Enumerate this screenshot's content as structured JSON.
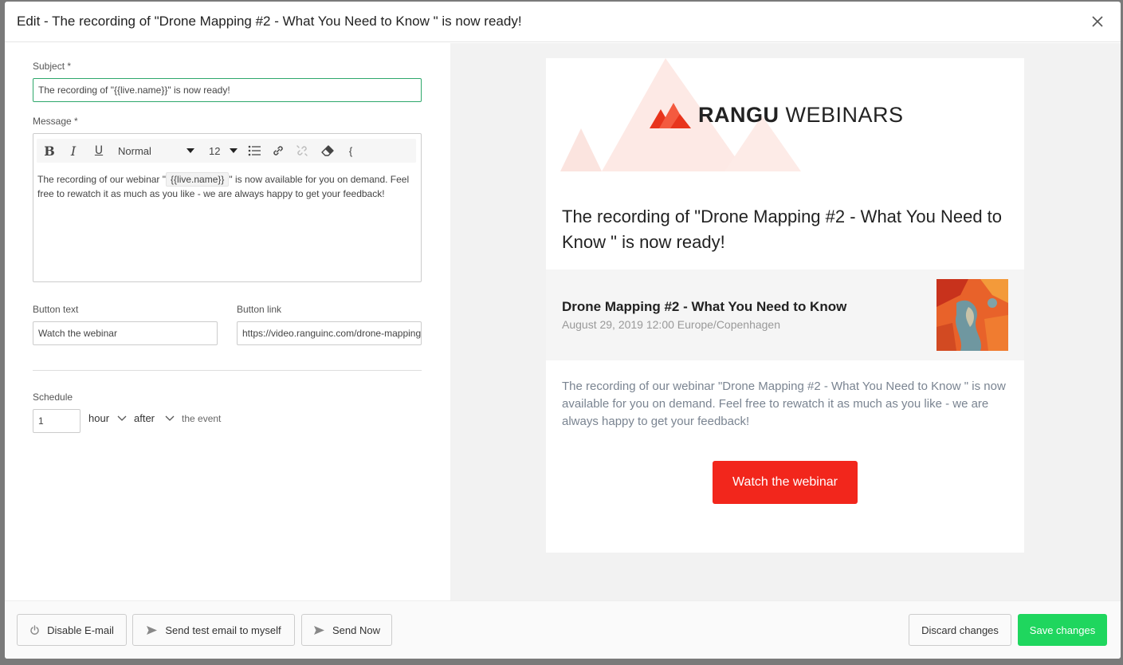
{
  "modal": {
    "title": "Edit - The recording of \"Drone Mapping #2 - What You Need to Know \" is now ready!"
  },
  "form": {
    "subject_label": "Subject *",
    "subject_value": "The recording of \"{{live.name}}\" is now ready!",
    "message_label": "Message *",
    "toolbar": {
      "bold": "B",
      "italic": "I",
      "underline": "U",
      "format_value": "Normal",
      "size_value": "12",
      "extra": "{"
    },
    "message_before": "The recording of our webinar \"",
    "message_token": "{{live.name}}",
    "message_after": "\" is now available for you on demand. Feel free to rewatch it as much as you like - we are always happy to get your feedback!",
    "button_text_label": "Button text",
    "button_text_value": "Watch the webinar",
    "button_link_label": "Button link",
    "button_link_value": "https://video.ranguinc.com/drone-mapping",
    "schedule_label": "Schedule",
    "schedule_amount": "1",
    "schedule_unit": "hour",
    "schedule_relation": "after",
    "schedule_suffix": "the event"
  },
  "preview": {
    "logo_bold": "RANGU",
    "logo_light": " WEBINARS",
    "title": "The recording of \"Drone Mapping #2 - What You Need to Know \" is now ready!",
    "event_name": "Drone Mapping #2 - What You Need to Know",
    "event_date": "August 29, 2019 12:00 Europe/Copenhagen",
    "body": "The recording of our webinar \"Drone Mapping #2 - What You Need to Know \" is now available for you on demand. Feel free to rewatch it as much as you like - we are always happy to get your feedback!",
    "cta_label": "Watch the webinar"
  },
  "footer": {
    "disable_label": "Disable E-mail",
    "test_label": "Send test email to myself",
    "send_now_label": "Send Now",
    "discard_label": "Discard changes",
    "save_label": "Save changes"
  },
  "colors": {
    "primary_green": "#1fd65e",
    "cta_red": "#f2261c",
    "focus_green": "#2ea86b"
  }
}
